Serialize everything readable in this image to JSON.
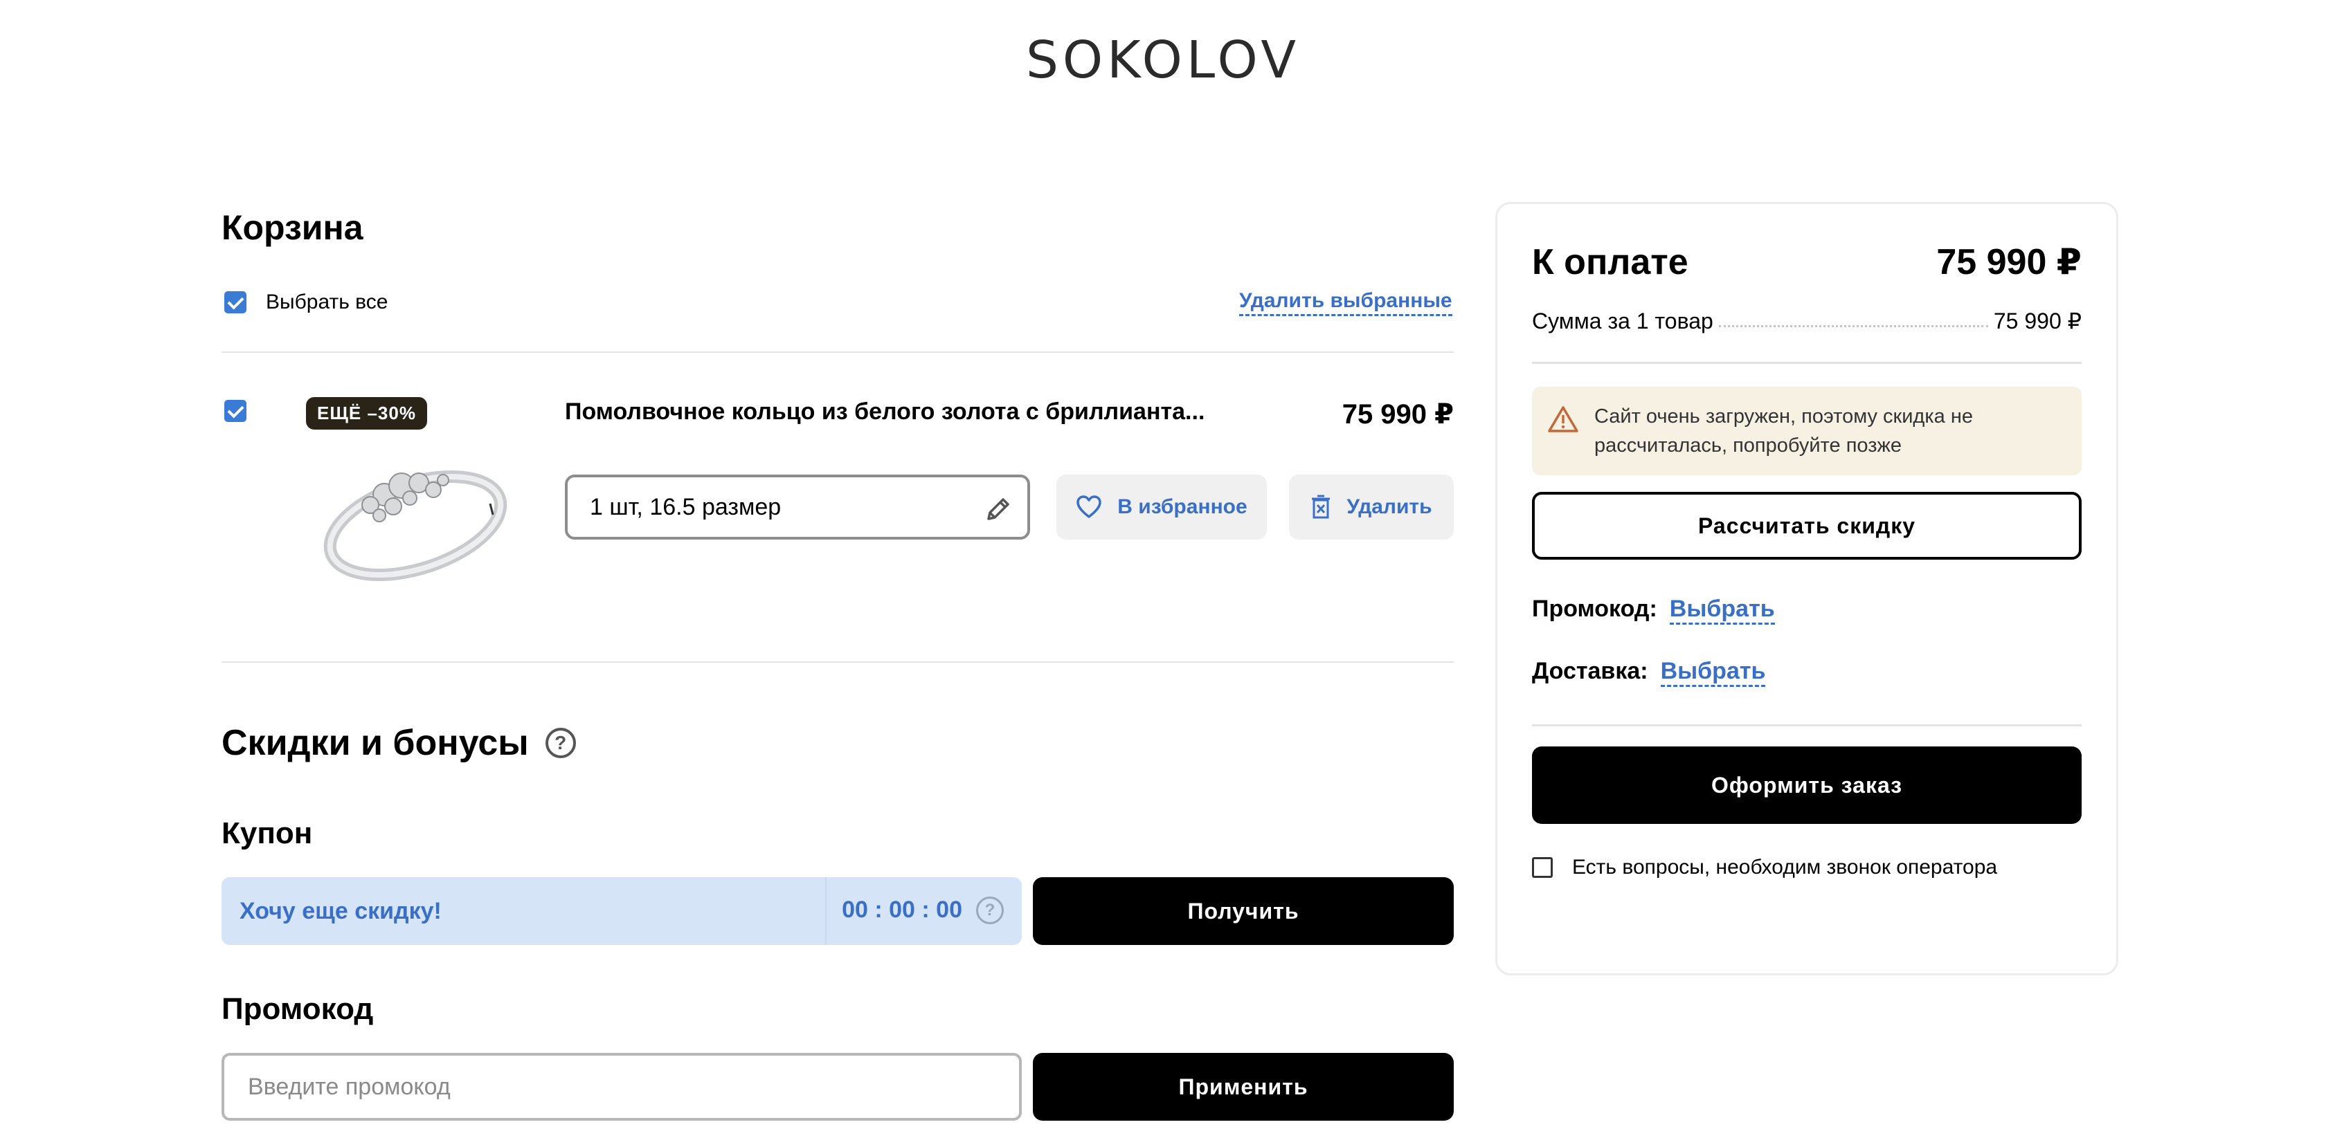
{
  "brand": {
    "logo": "SOKOLOV"
  },
  "cart": {
    "title": "Корзина",
    "select_all_label": "Выбрать все",
    "delete_selected": "Удалить выбранные",
    "item": {
      "badge": "ЕЩЁ –30%",
      "name": "Помолвочное кольцо из белого золота с бриллианта...",
      "price": "75 990 ₽",
      "variant": "1 шт, 16.5 размер",
      "favorite_label": "В избранное",
      "delete_label": "Удалить"
    }
  },
  "discounts": {
    "title": "Скидки и бонусы",
    "coupon": {
      "title": "Купон",
      "text": "Хочу еще скидку!",
      "timer": "00 : 00 : 00",
      "button": "Получить"
    },
    "promo": {
      "title": "Промокод",
      "placeholder": "Введите промокод",
      "button": "Применить"
    }
  },
  "summary": {
    "title": "К оплате",
    "total": "75 990 ₽",
    "sum_label": "Сумма за 1 товар",
    "sum_value": "75 990 ₽",
    "warning": "Сайт очень загружен, поэтому скидка не рассчиталась, попробуйте позже",
    "calc_button": "Рассчитать скидку",
    "promo_label": "Промокод:",
    "promo_link": "Выбрать",
    "delivery_label": "Доставка:",
    "delivery_link": "Выбрать",
    "order_button": "Оформить заказ",
    "call_label": "Есть вопросы, необходим звонок оператора"
  },
  "colors": {
    "accent_blue": "#3a6fc8",
    "coupon_bg": "#d5e4f7",
    "warning_bg": "#f7f1e3",
    "badge_bg": "#2a2418"
  }
}
